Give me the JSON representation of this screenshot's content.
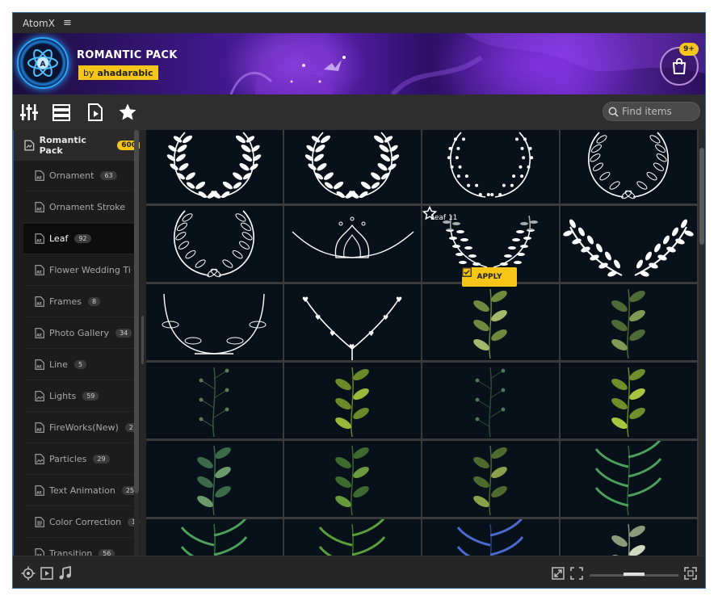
{
  "window": {
    "title": "AtomX",
    "menu_glyph": "≡"
  },
  "banner": {
    "pack_title": "ROMANTIC PACK",
    "by": "by",
    "author": "ahadarabic",
    "cart_badge": "9+"
  },
  "toolbar": {
    "search_placeholder": "Find items",
    "icons": [
      "sliders-icon",
      "list-icon",
      "video-file-icon",
      "star-icon"
    ]
  },
  "sidebar": {
    "category": {
      "label": "Romantic Pack",
      "count": "600"
    },
    "items": [
      {
        "label": "Ornament",
        "count": "63"
      },
      {
        "label": "Ornament Stroke",
        "count": ""
      },
      {
        "label": "Leaf",
        "count": "92"
      },
      {
        "label": "Flower Wedding Ti",
        "count": ""
      },
      {
        "label": "Frames",
        "count": "8"
      },
      {
        "label": "Photo Gallery",
        "count": "34"
      },
      {
        "label": "Line",
        "count": "5"
      },
      {
        "label": "Lights",
        "count": "59"
      },
      {
        "label": "FireWorks(New)",
        "count": "2"
      },
      {
        "label": "Particles",
        "count": "29"
      },
      {
        "label": "Text Animation",
        "count": "25"
      },
      {
        "label": "Color Correction",
        "count": "1"
      },
      {
        "label": "Transition",
        "count": "56"
      }
    ]
  },
  "hovered_tile": {
    "label": "Leaf 11",
    "apply_label": "APPLY"
  },
  "colors": {
    "accent": "#f5c518",
    "tile_bg": "#08101a",
    "selection": "#0d0d0d"
  }
}
